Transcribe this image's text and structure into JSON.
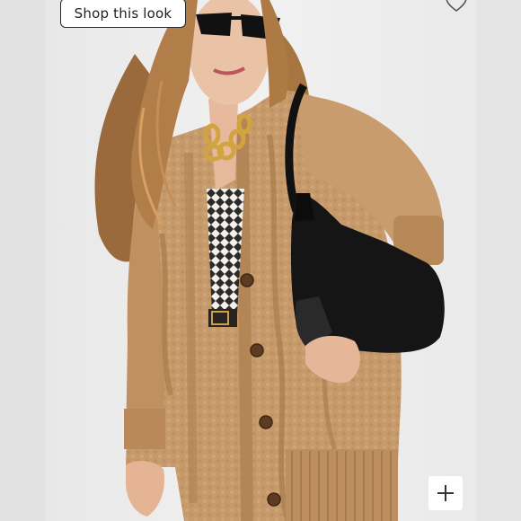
{
  "shop_button": {
    "label": "Shop this look"
  },
  "icons": {
    "favorite": "heart-outline-icon",
    "zoom": "plus-icon"
  },
  "colors": {
    "background": "#ececec",
    "cardigan": "#c79a6c",
    "jeans": "#4f76a6",
    "bag": "#161616",
    "button_border": "#2a2a2a"
  }
}
